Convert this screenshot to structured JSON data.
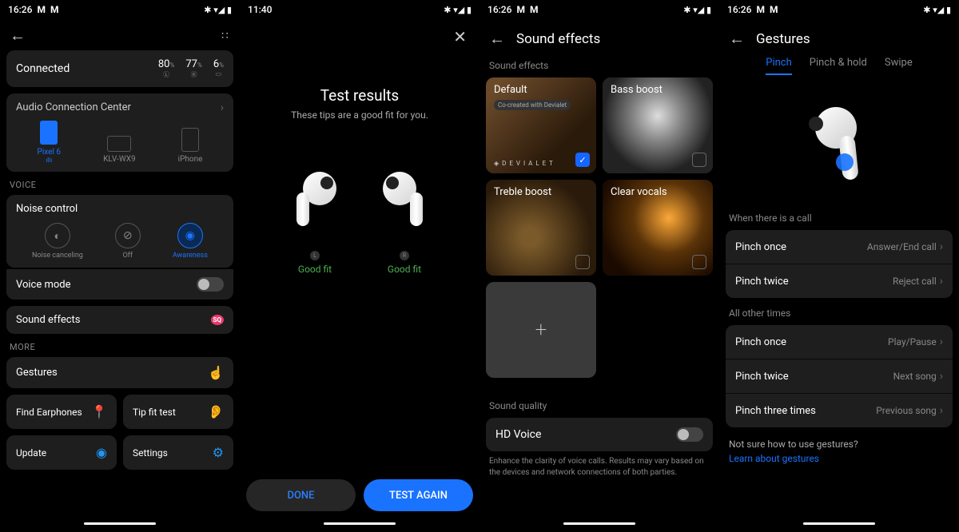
{
  "status": {
    "s1": {
      "time": "16:26",
      "icons": "✱ ▾◢ ▮"
    },
    "s2": {
      "time": "11:40",
      "icons": "✱ ▾◢ ▮"
    },
    "s3": {
      "time": "16:26",
      "icons": "✱ ▾◢ ▮"
    },
    "s4": {
      "time": "16:26",
      "icons": "✱ ▾◢ ▮"
    }
  },
  "screen1": {
    "connected": "Connected",
    "battery": {
      "left": "80",
      "right": "77",
      "case": "6",
      "pct": "%"
    },
    "acc_title": "Audio Connection Center",
    "devices": [
      {
        "label": "Pixel 6",
        "active": true
      },
      {
        "label": "KLV-WX9",
        "active": false
      },
      {
        "label": "iPhone",
        "active": false
      }
    ],
    "sec_voice": "VOICE",
    "noise_control": "Noise control",
    "noise_modes": [
      {
        "label": "Noise canceling",
        "icon": "◐"
      },
      {
        "label": "Off",
        "icon": "⊘"
      },
      {
        "label": "Awareness",
        "icon": "◉"
      }
    ],
    "voice_mode": "Voice mode",
    "sound_effects": "Sound effects",
    "sq_badge": "SQ",
    "sec_more": "MORE",
    "gestures": "Gestures",
    "find": "Find Earphones",
    "tip_fit": "Tip fit test",
    "update": "Update",
    "settings": "Settings"
  },
  "screen2": {
    "title": "Test results",
    "subtitle": "These tips are a good fit for you.",
    "left_tag": "L",
    "right_tag": "R",
    "fit_left": "Good fit",
    "fit_right": "Good fit",
    "done": "DONE",
    "test_again": "TEST AGAIN"
  },
  "screen3": {
    "title": "Sound effects",
    "sub1": "Sound effects",
    "effects": {
      "default": "Default",
      "default_sub": "Co-created with Devialet",
      "devialet": "◈ D E V I A L E T",
      "bass": "Bass boost",
      "treble": "Treble boost",
      "clear": "Clear vocals"
    },
    "add": "+",
    "sub2": "Sound quality",
    "hd_voice": "HD Voice",
    "hd_desc": "Enhance the clarity of voice calls. Results may vary based on the devices and network connections of both parties."
  },
  "screen4": {
    "title": "Gestures",
    "tabs": {
      "pinch": "Pinch",
      "hold": "Pinch & hold",
      "swipe": "Swipe"
    },
    "sec_call": "When there is a call",
    "call": [
      {
        "label": "Pinch once",
        "value": "Answer/End call"
      },
      {
        "label": "Pinch twice",
        "value": "Reject call"
      }
    ],
    "sec_other": "All other times",
    "other": [
      {
        "label": "Pinch once",
        "value": "Play/Pause"
      },
      {
        "label": "Pinch twice",
        "value": "Next song"
      },
      {
        "label": "Pinch three times",
        "value": "Previous song"
      }
    ],
    "not_sure": "Not sure how to use gestures?",
    "learn": "Learn about gestures"
  }
}
